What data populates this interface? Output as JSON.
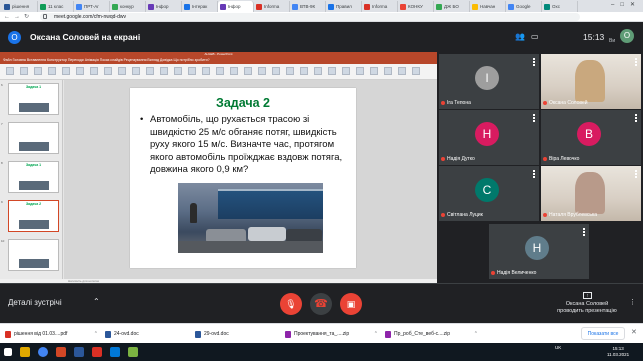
{
  "browser": {
    "tabs": [
      {
        "label": "рішення",
        "color": "#2b5797"
      },
      {
        "label": "11 клас",
        "color": "#0f9d58"
      },
      {
        "label": "ПРТ-Аr",
        "color": "#4285f4"
      },
      {
        "label": "конкур",
        "color": "#34a853"
      },
      {
        "label": "Інфор",
        "color": "#673ab7"
      },
      {
        "label": "Інтерак",
        "color": "#1a73e8"
      },
      {
        "label": "Інфор",
        "color": "#673ab7"
      },
      {
        "label": "Informa",
        "color": "#d93025"
      },
      {
        "label": "ВТВ-9К",
        "color": "#4285f4"
      },
      {
        "label": "Правил",
        "color": "#1a73e8"
      },
      {
        "label": "Informa",
        "color": "#d93025"
      },
      {
        "label": "КОНКУ",
        "color": "#ea4335"
      },
      {
        "label": "ДЖ БО",
        "color": "#34a853"
      },
      {
        "label": "Навчан",
        "color": "#fbbc04"
      },
      {
        "label": "Google",
        "color": "#4285f4"
      },
      {
        "label": "Oxc",
        "color": "#00897b"
      }
    ],
    "url": "meet.google.com/cfm-nwqd-dwv"
  },
  "meet": {
    "meeting_title": "Оксана Соловей на екрані",
    "presenter_initial": "О",
    "time": "15:13",
    "you_label": "Ви",
    "self_initial": "О",
    "participants": [
      {
        "name": "Іга Тепона",
        "initial": "І",
        "color": "#9e9e9e",
        "photo": false
      },
      {
        "name": "Оксана Соловей",
        "initial": "",
        "color": "#c9a87e",
        "photo": true
      },
      {
        "name": "Надія Дутко",
        "initial": "Н",
        "color": "#d81b60",
        "photo": false
      },
      {
        "name": "Віра Левочко",
        "initial": "В",
        "color": "#d81b60",
        "photo": false
      },
      {
        "name": "Світлана Луцик",
        "initial": "С",
        "color": "#00796b",
        "photo": false
      },
      {
        "name": "Наталя Врублевська",
        "initial": "",
        "color": "#b89a8a",
        "photo": true
      },
      {
        "name": "Надія Величенко",
        "initial": "Н",
        "color": "#607d8b",
        "photo": false
      }
    ],
    "bottom": {
      "details_label": "Деталі зустрічі",
      "presenter_line1": "Оксана Соловей",
      "presenter_line2": "проводить презентацію"
    }
  },
  "ppt": {
    "window_title": "ALGEB - PowerPoint",
    "menu": "Файл   Головна   Вставлення   Конструктор   Переходи   Анімація   Показ слайдів   Рецензування   Вигляд   Довідка   Що потрібно зробити?",
    "slide_title": "Задача 2",
    "slide_text": "Автомобіль, що рухається трасою зі швидкістю 25 м/с обганяє потяг, швидкість руху якого 15 м/с. Визначте час, протягом якого автомобіль проїжджає вздовж потяга, довжина якого 0,9 км?",
    "notes": "Натисніть для нотаток",
    "thumbnails": [
      {
        "num": "6",
        "title": "Задача 1"
      },
      {
        "num": "7",
        "title": ""
      },
      {
        "num": "8",
        "title": "Задача 1"
      },
      {
        "num": "9",
        "title": "Задача 2"
      },
      {
        "num": "10",
        "title": ""
      }
    ]
  },
  "downloads": [
    {
      "name": "рішення від 01.03....pdf",
      "color": "#d93025"
    },
    {
      "name": "24-ovd.doc",
      "color": "#2b579a"
    },
    {
      "name": "29-ovd.doc",
      "color": "#2b579a"
    },
    {
      "name": "Проектування_та_....zip",
      "color": "#8e24aa"
    },
    {
      "name": "Пр_роб_Сте_веб-с....zip",
      "color": "#8e24aa"
    }
  ],
  "downloads_show_all": "Показати все",
  "taskbar": {
    "tray": "UK",
    "clock_time": "15:13",
    "clock_date": "11.03.2021"
  }
}
